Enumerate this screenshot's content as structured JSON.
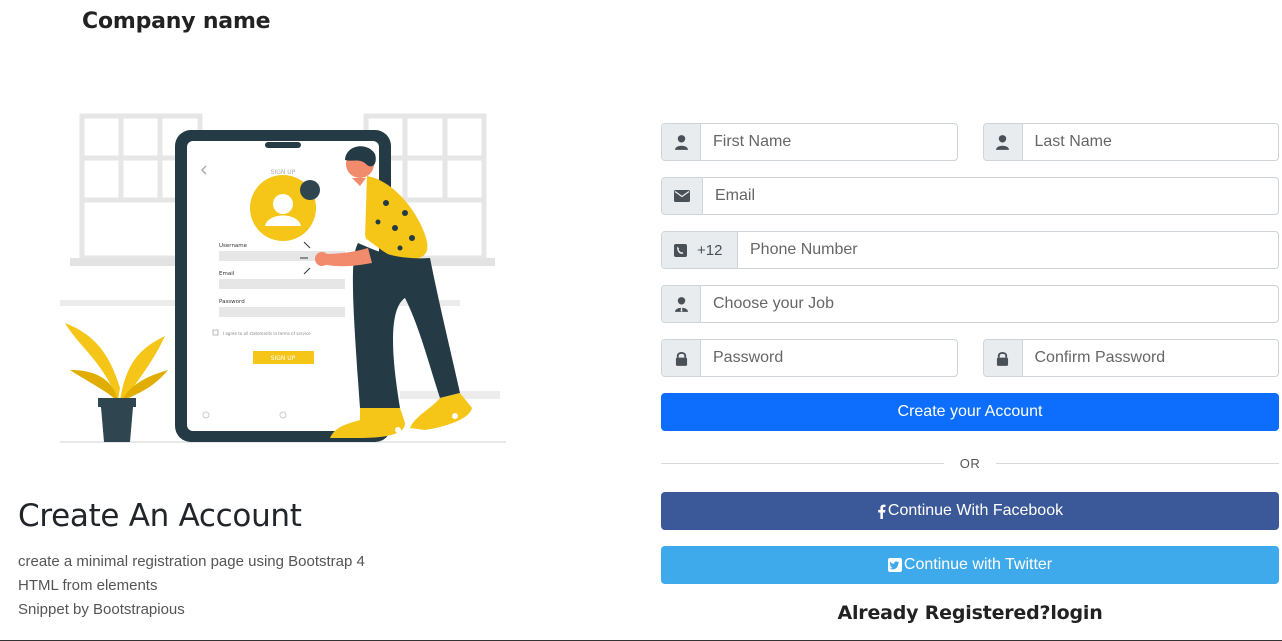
{
  "header": {
    "brand": "Company name"
  },
  "illustration": {
    "screen_title": "SIGN UP",
    "username_label": "Username",
    "email_label": "Email",
    "password_label": "Password",
    "agree_text": "I agree to all statements in terms of service",
    "signup_button": "SIGN UP"
  },
  "intro": {
    "title": "Create An Account",
    "lines": [
      "create a minimal registration page using Bootstrap 4",
      "HTML from elements",
      "Snippet by Bootstrapious"
    ]
  },
  "form": {
    "first_name": {
      "placeholder": "First Name",
      "icon": "user-icon"
    },
    "last_name": {
      "placeholder": "Last Name",
      "icon": "user-icon"
    },
    "email": {
      "placeholder": "Email",
      "icon": "envelope-icon"
    },
    "phone": {
      "prefix": "+12",
      "placeholder": "Phone Number",
      "icon": "phone-icon"
    },
    "job": {
      "placeholder": "Choose your Job",
      "icon": "user-tie-icon"
    },
    "password": {
      "placeholder": "Password",
      "icon": "lock-icon"
    },
    "confirm_password": {
      "placeholder": "Confirm Password",
      "icon": "lock-icon"
    },
    "submit_label": "Create your Account",
    "divider": "OR",
    "facebook_label": "Continue With Facebook",
    "twitter_label": "Continue with Twitter",
    "login_text": "Already Registered?login"
  },
  "colors": {
    "primary": "#0d6efd",
    "facebook": "#3b5998",
    "twitter": "#3eaaeb",
    "accent_yellow": "#f5c518"
  }
}
